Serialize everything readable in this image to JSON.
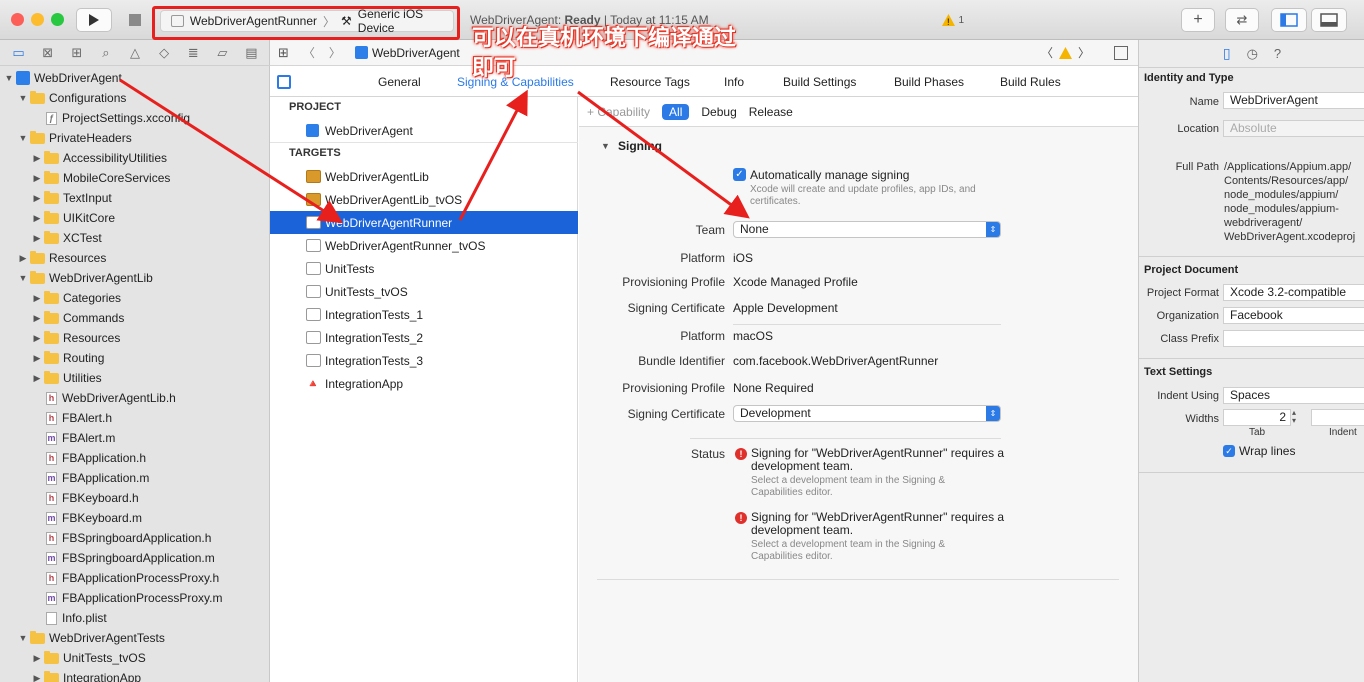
{
  "toolbar": {
    "scheme": "WebDriverAgentRunner",
    "destination": "Generic iOS Device",
    "status_app": "WebDriverAgent:",
    "status_state": "Ready",
    "status_time": "| Today at 11:15 AM",
    "warning_count": "1"
  },
  "navigator": {
    "items": [
      {
        "label": "WebDriverAgent",
        "kind": "project",
        "level": 0,
        "open": true
      },
      {
        "label": "Configurations",
        "kind": "folder",
        "level": 1,
        "open": true
      },
      {
        "label": "ProjectSettings.xcconfig",
        "kind": "config",
        "level": 2
      },
      {
        "label": "PrivateHeaders",
        "kind": "folder",
        "level": 1,
        "open": true
      },
      {
        "label": "AccessibilityUtilities",
        "kind": "folder",
        "level": 2,
        "open": false
      },
      {
        "label": "MobileCoreServices",
        "kind": "folder",
        "level": 2,
        "open": false
      },
      {
        "label": "TextInput",
        "kind": "folder",
        "level": 2,
        "open": false
      },
      {
        "label": "UIKitCore",
        "kind": "folder",
        "level": 2,
        "open": false
      },
      {
        "label": "XCTest",
        "kind": "folder",
        "level": 2,
        "open": false
      },
      {
        "label": "Resources",
        "kind": "folder",
        "level": 1,
        "open": false
      },
      {
        "label": "WebDriverAgentLib",
        "kind": "folder",
        "level": 1,
        "open": true
      },
      {
        "label": "Categories",
        "kind": "folder",
        "level": 2,
        "open": false
      },
      {
        "label": "Commands",
        "kind": "folder",
        "level": 2,
        "open": false
      },
      {
        "label": "Resources",
        "kind": "folder",
        "level": 2,
        "open": false
      },
      {
        "label": "Routing",
        "kind": "folder",
        "level": 2,
        "open": false
      },
      {
        "label": "Utilities",
        "kind": "folder",
        "level": 2,
        "open": false
      },
      {
        "label": "WebDriverAgentLib.h",
        "kind": "h",
        "level": 2
      },
      {
        "label": "FBAlert.h",
        "kind": "h",
        "level": 2
      },
      {
        "label": "FBAlert.m",
        "kind": "m",
        "level": 2
      },
      {
        "label": "FBApplication.h",
        "kind": "h",
        "level": 2
      },
      {
        "label": "FBApplication.m",
        "kind": "m",
        "level": 2
      },
      {
        "label": "FBKeyboard.h",
        "kind": "h",
        "level": 2
      },
      {
        "label": "FBKeyboard.m",
        "kind": "m",
        "level": 2
      },
      {
        "label": "FBSpringboardApplication.h",
        "kind": "h",
        "level": 2
      },
      {
        "label": "FBSpringboardApplication.m",
        "kind": "m",
        "level": 2
      },
      {
        "label": "FBApplicationProcessProxy.h",
        "kind": "h",
        "level": 2
      },
      {
        "label": "FBApplicationProcessProxy.m",
        "kind": "m",
        "level": 2
      },
      {
        "label": "Info.plist",
        "kind": "plist",
        "level": 2
      },
      {
        "label": "WebDriverAgentTests",
        "kind": "folder",
        "level": 1,
        "open": true
      },
      {
        "label": "UnitTests_tvOS",
        "kind": "folder",
        "level": 2,
        "open": false
      },
      {
        "label": "IntegrationApp",
        "kind": "folder",
        "level": 2,
        "open": false
      }
    ]
  },
  "editor": {
    "breadcrumb": "WebDriverAgent",
    "tabs": [
      "General",
      "Signing & Capabilities",
      "Resource Tags",
      "Info",
      "Build Settings",
      "Build Phases",
      "Build Rules"
    ],
    "project_header": "PROJECT",
    "project_name": "WebDriverAgent",
    "targets_header": "TARGETS",
    "targets": [
      "WebDriverAgentLib",
      "WebDriverAgentLib_tvOS",
      "WebDriverAgentRunner",
      "WebDriverAgentRunner_tvOS",
      "UnitTests",
      "UnitTests_tvOS",
      "IntegrationTests_1",
      "IntegrationTests_2",
      "IntegrationTests_3",
      "IntegrationApp"
    ],
    "capability_btn": "+ Capability",
    "filters": [
      "All",
      "Debug",
      "Release"
    ]
  },
  "signing": {
    "title": "Signing",
    "auto_label": "Automatically manage signing",
    "auto_note": "Xcode will create and update profiles, app IDs, and certificates.",
    "team_label": "Team",
    "team_value": "None",
    "platform_label": "Platform",
    "platform_ios": "iOS",
    "prov_label": "Provisioning Profile",
    "prov_ios": "Xcode Managed Profile",
    "cert_label": "Signing Certificate",
    "cert_ios": "Apple Development",
    "platform_mac": "macOS",
    "bundle_label": "Bundle Identifier",
    "bundle_value": "com.facebook.WebDriverAgentRunner",
    "prov_mac": "None Required",
    "cert_mac": "Development",
    "status_label": "Status",
    "status_msg": "Signing for \"WebDriverAgentRunner\" requires a development team.",
    "status_note": "Select a development team in the Signing & Capabilities editor."
  },
  "inspector": {
    "identity_head": "Identity and Type",
    "name_label": "Name",
    "name_value": "WebDriverAgent",
    "location_label": "Location",
    "location_value": "Absolute",
    "fullpath_label": "Full Path",
    "fullpath_value": "/Applications/Appium.app/ Contents/Resources/app/ node_modules/appium/ node_modules/appium-webdriveragent/ WebDriverAgent.xcodeproj",
    "doc_head": "Project Document",
    "format_label": "Project Format",
    "format_value": "Xcode 3.2-compatible",
    "org_label": "Organization",
    "org_value": "Facebook",
    "prefix_label": "Class Prefix",
    "text_head": "Text Settings",
    "indent_label": "Indent Using",
    "indent_value": "Spaces",
    "widths_label": "Widths",
    "tab_value": "2",
    "tab_caption": "Tab",
    "indent_caption": "Indent",
    "wrap_label": "Wrap lines"
  },
  "annotation": {
    "line1": "可以在真机环境下编译通过",
    "line2": "即可",
    "color": "#e8201d"
  },
  "colors": {
    "accent": "#2b7ae6",
    "selection": "#1a63d8",
    "annotation": "#e8201d"
  }
}
